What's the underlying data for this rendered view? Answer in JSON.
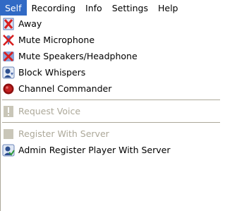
{
  "menubar": {
    "items": [
      "Self",
      "Recording",
      "Info",
      "Settings",
      "Help"
    ],
    "active": "Self"
  },
  "menu": {
    "items": [
      {
        "label": "Away",
        "icon": "away-icon",
        "enabled": true
      },
      {
        "label": "Mute Microphone",
        "icon": "mute-microphone-icon",
        "enabled": true
      },
      {
        "label": "Mute Speakers/Headphone",
        "icon": "mute-speakers-icon",
        "enabled": true
      },
      {
        "label": "Block Whispers",
        "icon": "block-whispers-icon",
        "enabled": true
      },
      {
        "label": "Channel Commander",
        "icon": "channel-commander-icon",
        "enabled": true
      },
      {
        "label": "Request Voice",
        "icon": "request-voice-icon",
        "enabled": false
      },
      {
        "label": "Register With Server",
        "icon": "register-icon",
        "enabled": false
      },
      {
        "label": "Admin Register Player With Server",
        "icon": "admin-register-icon",
        "enabled": true
      }
    ]
  },
  "colors": {
    "highlight": "#316ac5",
    "disabled_text": "#aca899"
  }
}
